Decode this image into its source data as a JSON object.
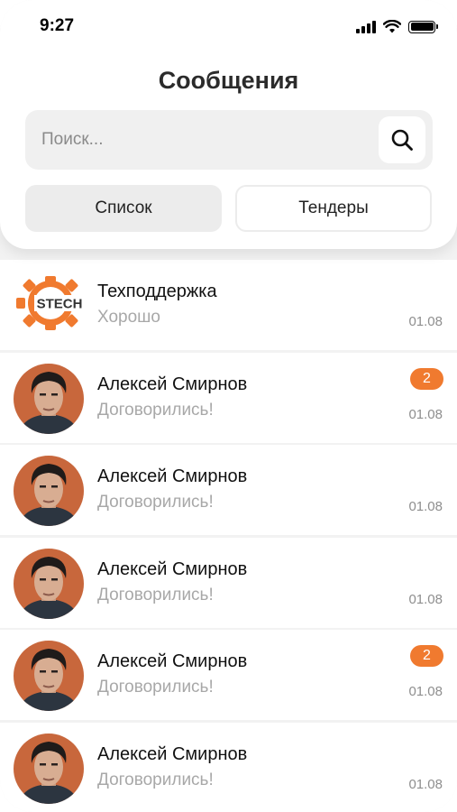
{
  "status_bar": {
    "time": "9:27"
  },
  "header": {
    "title": "Сообщения"
  },
  "search": {
    "placeholder": "Поиск...",
    "value": ""
  },
  "tabs": [
    {
      "label": "Список",
      "active": true
    },
    {
      "label": "Тендеры",
      "active": false
    }
  ],
  "colors": {
    "accent": "#f07a2f",
    "background": "#f2f2f2"
  },
  "chats": [
    {
      "name": "Техподдержка",
      "preview": "Хорошо",
      "date": "01.08",
      "unread": "",
      "avatar": "stech-logo",
      "logo_text": "STECH"
    },
    {
      "name": "Алексей Смирнов",
      "preview": "Договорились!",
      "date": "01.08",
      "unread": "2",
      "avatar": "user-photo"
    },
    {
      "name": "Алексей Смирнов",
      "preview": "Договорились!",
      "date": "01.08",
      "unread": "",
      "avatar": "user-photo"
    },
    {
      "name": "Алексей Смирнов",
      "preview": "Договорились!",
      "date": "01.08",
      "unread": "",
      "avatar": "user-photo"
    },
    {
      "name": "Алексей Смирнов",
      "preview": "Договорились!",
      "date": "01.08",
      "unread": "2",
      "avatar": "user-photo"
    },
    {
      "name": "Алексей Смирнов",
      "preview": "Договорились!",
      "date": "01.08",
      "unread": "",
      "avatar": "user-photo"
    }
  ]
}
